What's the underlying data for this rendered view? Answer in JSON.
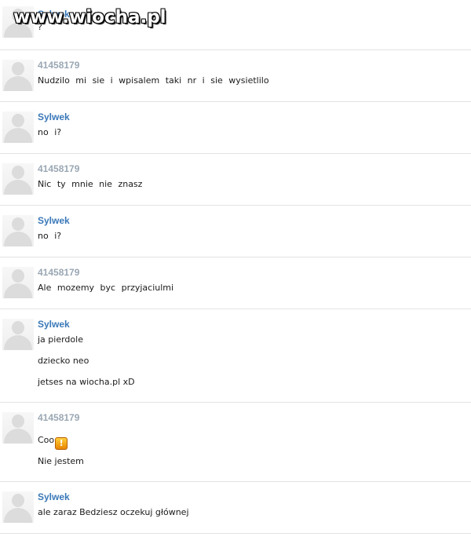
{
  "watermark": "www.wiocha.pl",
  "colors": {
    "sylwek_name": "#3a78b8",
    "other_name": "#9aa7b3",
    "divider": "#e3e3e3",
    "emoticon": "#f0a010"
  },
  "messages": [
    {
      "author": "Sylwek",
      "lines": [
        "?"
      ]
    },
    {
      "author": "41458179",
      "lines": [
        "Nudzilo mi sie i wpisalem taki nr i sie wysietlilo"
      ]
    },
    {
      "author": "Sylwek",
      "lines": [
        "no i?"
      ]
    },
    {
      "author": "41458179",
      "lines": [
        "Nic ty mnie nie znasz"
      ]
    },
    {
      "author": "Sylwek",
      "lines": [
        "no i?"
      ]
    },
    {
      "author": "41458179",
      "lines": [
        "Ale mozemy byc przyjaciulmi"
      ]
    },
    {
      "author": "Sylwek",
      "lines": [
        "ja pierdole",
        "dziecko neo",
        "jetses na wiocha.pl xD"
      ]
    },
    {
      "author": "41458179",
      "lines": [
        "Coo",
        "Nie jestem"
      ],
      "emoticon": {
        "name": "exclamation-emoticon-icon",
        "glyph": "!"
      }
    },
    {
      "author": "Sylwek",
      "lines": [
        "ale zaraz Bedziesz oczekuj głównej"
      ]
    }
  ]
}
